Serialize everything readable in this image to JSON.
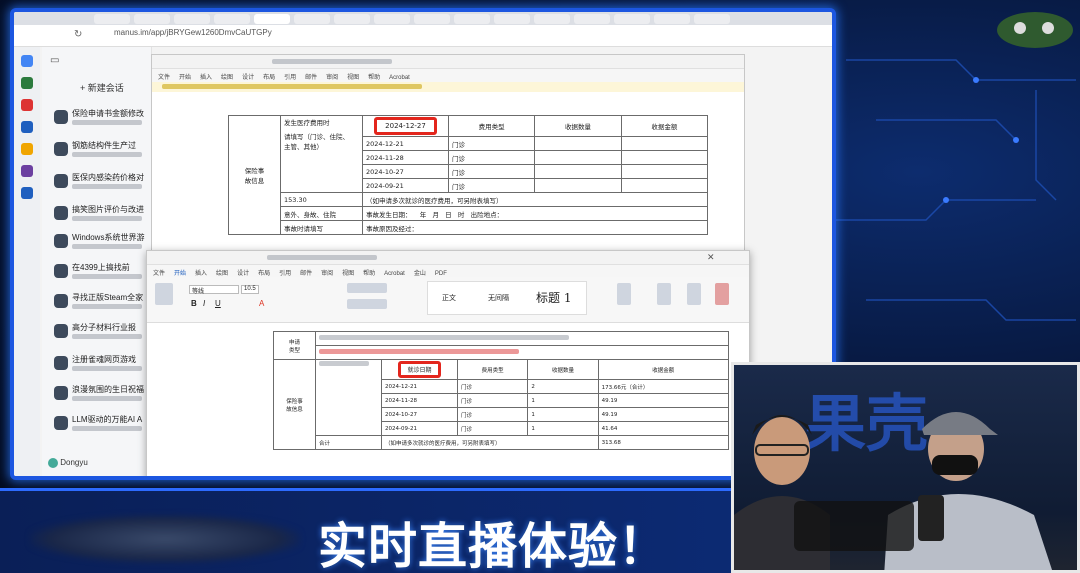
{
  "browser": {
    "url": "manus.im/app/jBRYGew1260DmvCaUTGPy"
  },
  "sidebar": {
    "new_chat": "+ 新建会话",
    "items": [
      {
        "title": "保险申请书金额修改"
      },
      {
        "title": "钢筋结构件生产过"
      },
      {
        "title": "医保内感染药价格对"
      },
      {
        "title": "搞笑图片评价与改进"
      },
      {
        "title": "Windows系统世界游"
      },
      {
        "title": "在4399上搞找前"
      },
      {
        "title": "寻找正版Steam全家"
      },
      {
        "title": "高分子材料行业报"
      },
      {
        "title": "注册雀魂网页游戏"
      },
      {
        "title": "浪漫氛围的生日祝福"
      },
      {
        "title": "LLM驱动的万能AI A"
      }
    ],
    "user": "Dongyu"
  },
  "word_back": {
    "menu": [
      "文件",
      "开始",
      "插入",
      "绘图",
      "设计",
      "布局",
      "引用",
      "邮件",
      "审阅",
      "视图",
      "帮助",
      "Acrobat"
    ],
    "highlight_date": "2024-12-27",
    "header": [
      "费用类型",
      "收据数量",
      "收据金额"
    ],
    "label_hosp": "发生医疗费用时",
    "label_fill": "请填写（门诊、住院、\n主管、其他）",
    "label_section": "保险事\n故信息",
    "dates": [
      "2024-12-21",
      "2024-11-28",
      "2024-10-27",
      "2024-09-21"
    ],
    "type": "门诊",
    "total": "153.30",
    "total_note": "（如申请多次就诊的医疗费用，可另附表填写）",
    "row_a": [
      "意外、身故、住院",
      "事故发生日期：",
      "年",
      "月",
      "日",
      "时",
      "出险地点："
    ],
    "row_b": [
      "事故时请填写",
      "事故原因及经过："
    ]
  },
  "word_front": {
    "menu": [
      "文件",
      "开始",
      "插入",
      "绘图",
      "设计",
      "布局",
      "引用",
      "邮件",
      "审阅",
      "视图",
      "帮助",
      "Acrobat",
      "金山",
      "PDF"
    ],
    "font_name": "等线",
    "font_size": "10.5",
    "styles": [
      "正文",
      "无间隔",
      "标题 1"
    ],
    "apply_label": "申请\n类型",
    "highlight_date": "就诊日期",
    "header": [
      "费用类型",
      "收据数量",
      "收据金额"
    ],
    "label_section": "保险事\n故信息",
    "rows": [
      {
        "date": "2024-12-21",
        "type": "门诊",
        "qty": "2",
        "amount": "173.66元（合计）"
      },
      {
        "date": "2024-11-28",
        "type": "门诊",
        "qty": "1",
        "amount": "49.19"
      },
      {
        "date": "2024-10-27",
        "type": "门诊",
        "qty": "1",
        "amount": "49.19"
      },
      {
        "date": "2024-09-21",
        "type": "门诊",
        "qty": "1",
        "amount": "41.64"
      }
    ],
    "total_label": "合计",
    "total_note": "（如申请多次就诊的医疗费用，可另附表填写）",
    "total": "313.68"
  },
  "caption": "实时直播体验！",
  "webcam": {
    "backdrop": "果壳"
  }
}
